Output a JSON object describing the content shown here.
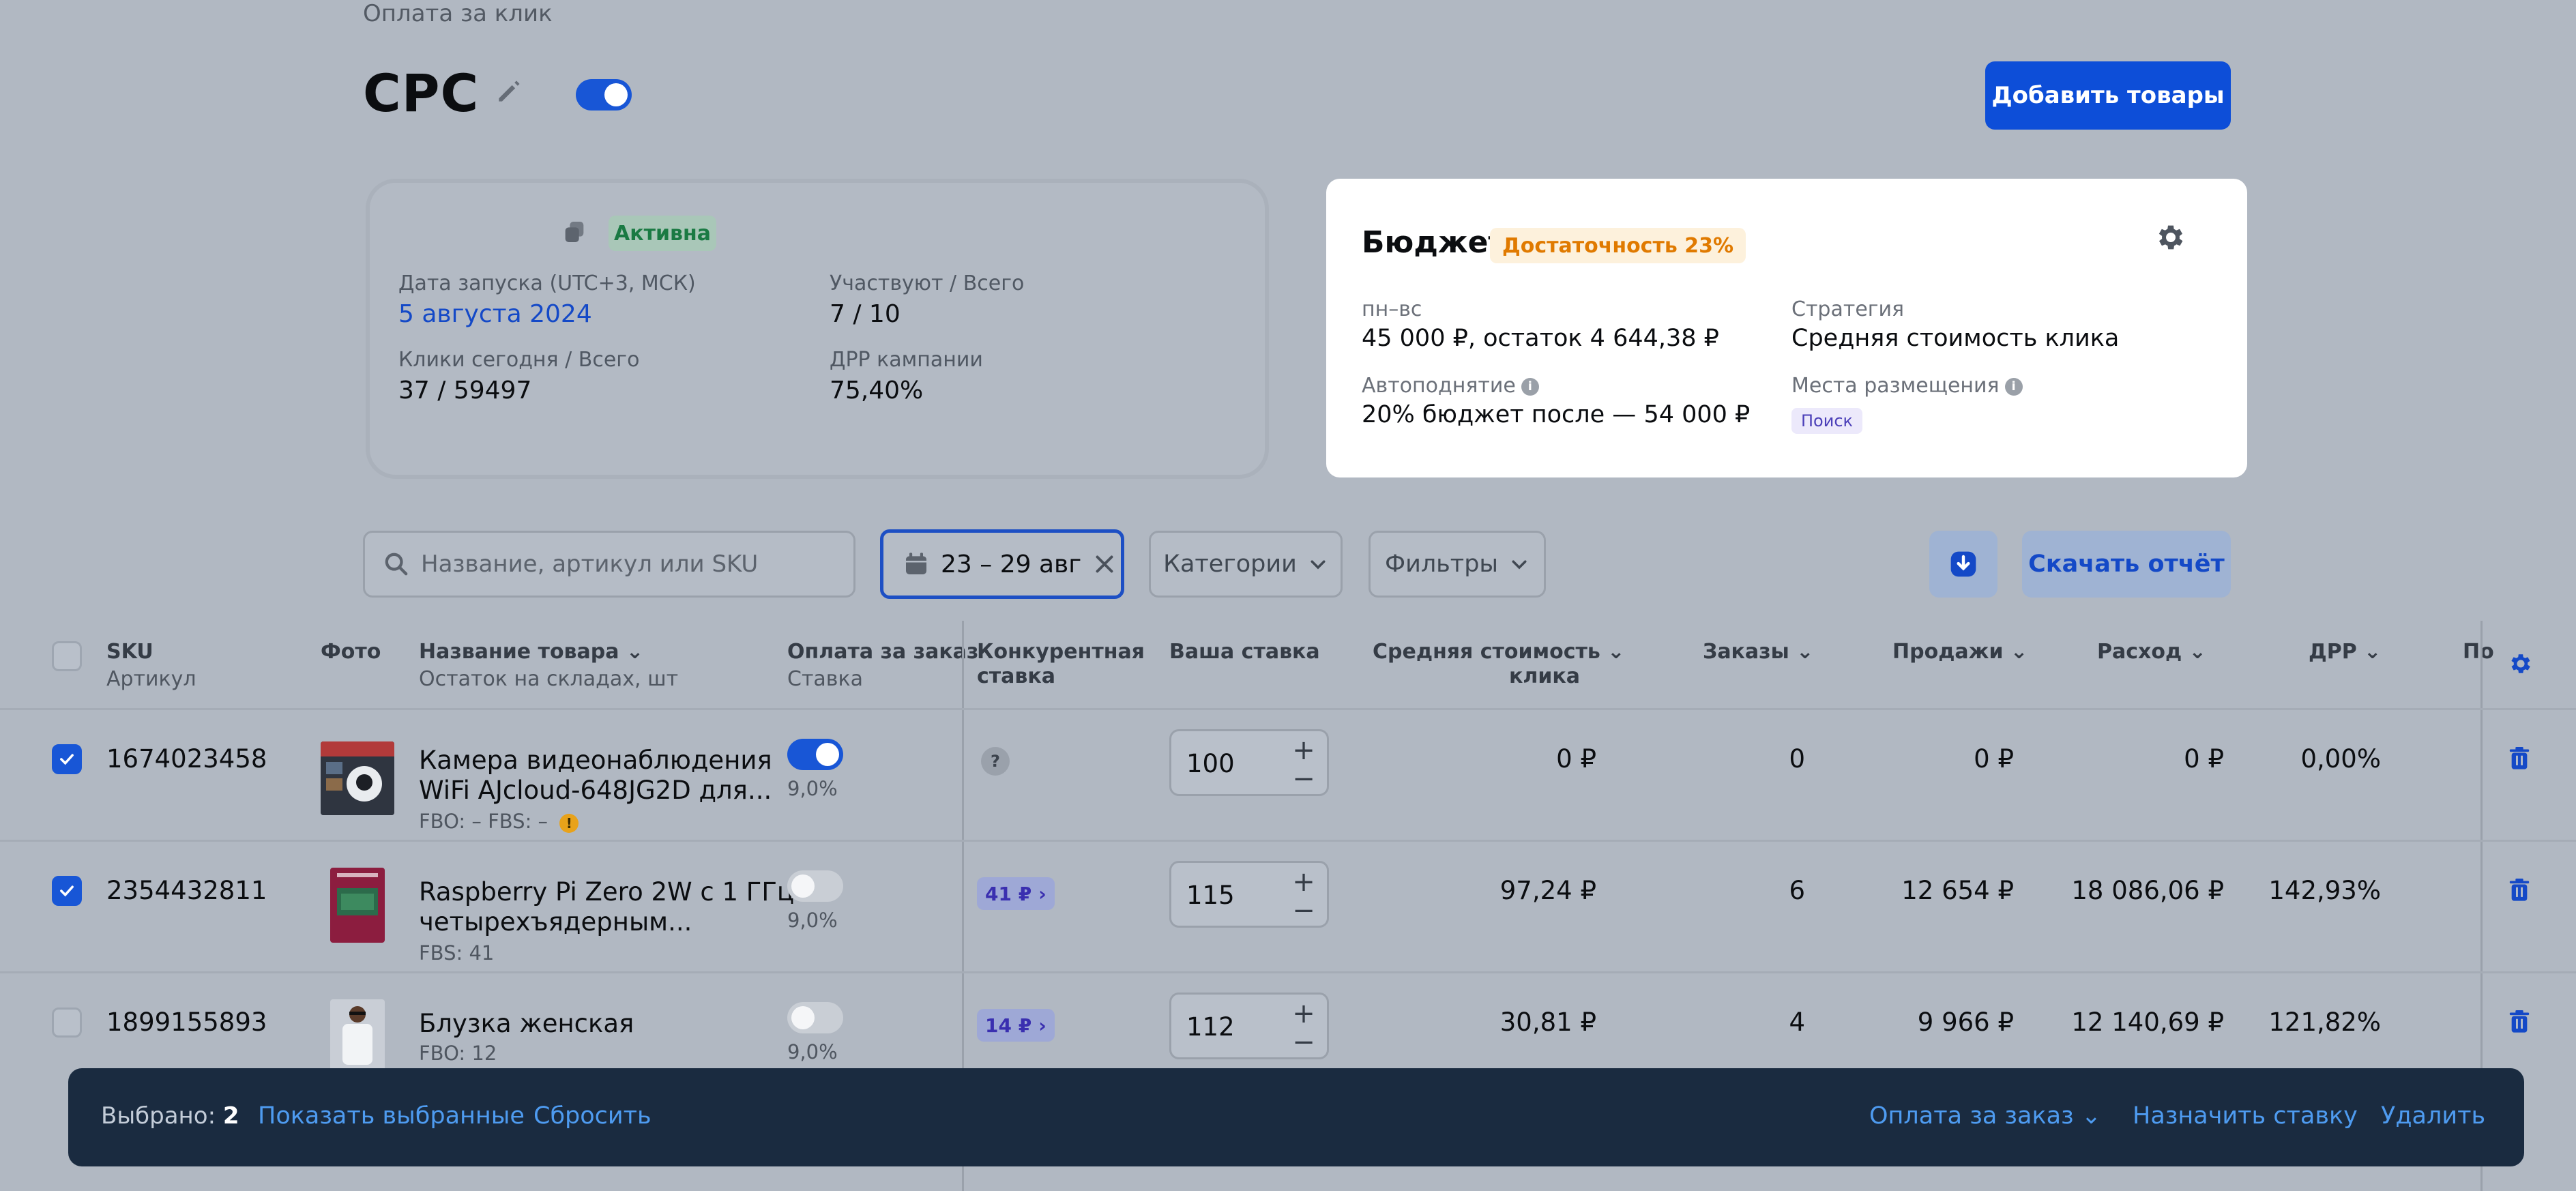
{
  "header": {
    "breadcrumb": "Оплата за клик",
    "title": "CPC",
    "add_products": "Добавить товары"
  },
  "campaign": {
    "status": "Активна",
    "launch_label": "Дата запуска (UTC+3, МСК)",
    "launch_value": "5 августа 2024",
    "participants_label": "Участвуют / Всего",
    "participants_value": "7 / 10",
    "clicks_label": "Клики сегодня / Всего",
    "clicks_value": "37 / 59497",
    "drr_label": "ДРР кампании",
    "drr_value": "75,40%"
  },
  "budget": {
    "title": "Бюджет",
    "badge": "Достаточность 23%",
    "period_label": "пн–вс",
    "period_value": "45 000 ₽, остаток 4 644,38 ₽",
    "strategy_label": "Стратегия",
    "strategy_value": "Средняя стоимость клика",
    "autoraise_label": "Автоподнятие",
    "autoraise_value": "20% бюджет после — 54 000 ₽",
    "placement_label": "Места размещения",
    "placement_value": "Поиск"
  },
  "toolbar": {
    "search_placeholder": "Название, артикул или SKU",
    "date_range": "23 – 29 авг",
    "categories": "Категории",
    "filters": "Фильтры",
    "download_report": "Скачать отчёт"
  },
  "table": {
    "columns": {
      "sku": "SKU",
      "sku_sub": "Артикул",
      "photo": "Фото",
      "name": "Название товара",
      "name_sub": "Остаток на складах, шт",
      "pay_order": "Оплата за заказ",
      "pay_order_sub": "Ставка",
      "competitive_1": "Конкурентная",
      "competitive_2": "ставка",
      "your_bid": "Ваша ставка",
      "avg_cost_1": "Средняя стоимость",
      "avg_cost_2": "клика",
      "orders": "Заказы",
      "sales": "Продажи",
      "spend": "Расход",
      "drr": "ДРР",
      "cut": "По"
    },
    "rows": [
      {
        "sku": "1674023458",
        "name_1": "Камера видеонаблюдения",
        "name_2": "WiFi AJcloud-648JG2D для...",
        "stock": "FBO: –   FBS: –",
        "rate": "9,0%",
        "bid": "100",
        "avg": "0 ₽",
        "orders": "0",
        "sales": "0 ₽",
        "spend": "0 ₽",
        "drr": "0,00%"
      },
      {
        "sku": "2354432811",
        "name_1": "Raspberry Pi Zero 2W с 1 ГГц",
        "name_2": "четырехъядерным...",
        "stock": "FBS: 41",
        "rate": "9,0%",
        "competitive": "41 ₽",
        "bid": "115",
        "avg": "97,24 ₽",
        "orders": "6",
        "sales": "12 654 ₽",
        "spend": "18 086,06 ₽",
        "drr": "142,93%"
      },
      {
        "sku": "1899155893",
        "name_1": "Блузка женская",
        "stock": "FBO: 12",
        "rate": "9,0%",
        "competitive": "14 ₽",
        "bid": "112",
        "avg": "30,81 ₽",
        "orders": "4",
        "sales": "9 966 ₽",
        "spend": "12 140,69 ₽",
        "drr": "121,82%"
      }
    ]
  },
  "action_bar": {
    "selected_label": "Выбрано:",
    "selected_count": "2",
    "show_selected": "Показать выбранные",
    "reset": "Сбросить",
    "pay_order": "Оплата за заказ",
    "set_bid": "Назначить ставку",
    "delete": "Удалить"
  }
}
